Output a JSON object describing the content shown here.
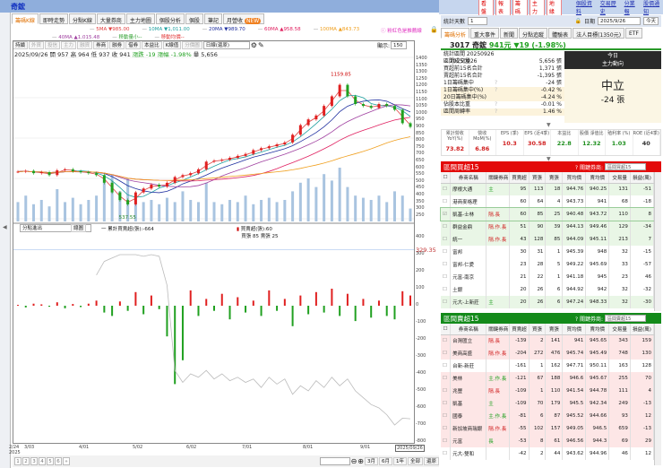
{
  "window": {
    "title": "奇鋐"
  },
  "tabs": [
    {
      "label": "籌碼K線",
      "active": true
    },
    {
      "label": "即時走勢"
    },
    {
      "label": "分點K線"
    },
    {
      "label": "大量券商"
    },
    {
      "label": "主力地圖"
    },
    {
      "label": "個股分析"
    },
    {
      "label": "個股"
    },
    {
      "label": "筆記"
    },
    {
      "label": "月營收",
      "badge": "NEW"
    }
  ],
  "ma_legend": {
    "row1": [
      {
        "label": "5MA ▼985.00",
        "color": "#e04040"
      },
      {
        "label": "10MA ▼1,011.00",
        "color": "#20a0a0"
      },
      {
        "label": "20MA ▼989.70",
        "color": "#2030a0"
      },
      {
        "label": "60MA ▲958.58",
        "color": "#e02060"
      },
      {
        "label": "100MA ▲843.73",
        "color": "#f0a020"
      }
    ],
    "row2": [
      {
        "label": "40MA ▲1,015.48",
        "color": "#a040a0"
      },
      {
        "label": "移動量小--",
        "color": "#30a030"
      },
      {
        "label": "移動均價--",
        "color": "#e03030"
      }
    ],
    "note": "ⓘ 粉紅色是推薦線"
  },
  "chart_toolbar": {
    "buttons": [
      "持續",
      "外資",
      "投信",
      "主力",
      "融資",
      "券商",
      "融劵",
      "借券",
      "本益比",
      "K線值",
      "分價圖"
    ],
    "disabled": [
      1,
      2,
      3,
      4,
      10
    ],
    "period": "日線(還原)",
    "display_label": "顯示:",
    "display_value": "150"
  },
  "info": {
    "date": "2025/09/26",
    "open": "開 957",
    "high": "高 964",
    "low": "低 937",
    "close": "收 941",
    "change": "漲跌 -19",
    "pct": "漲幅 -1.98%",
    "volume": "量 5,656"
  },
  "lower_panel": {
    "select": "分點進出",
    "button": "總圖",
    "cum_label": "一 累計買賣超(張):-664",
    "legend_net": "買賣超(張):60",
    "legend_bs": "買張 85 賣張 25",
    "highlight": "329.35"
  },
  "chart_data": [
    {
      "type": "candlestick",
      "price_ticks": [
        "1400",
        "1350",
        "1300",
        "1250",
        "1200",
        "1150",
        "1100",
        "1050",
        "1000",
        "950",
        "900",
        "850",
        "800",
        "750",
        "700",
        "650",
        "600",
        "550",
        "500",
        "450",
        "400",
        "350",
        "300",
        "250"
      ],
      "annotations": {
        "high": "1159.85",
        "low": "537.55"
      },
      "x_ticks": [
        "2/24",
        "3/03",
        "4/01",
        "5/02",
        "6/02",
        "7/01",
        "8/01",
        "9/01",
        "2025/09/26"
      ],
      "x_year": "2025",
      "closes": [
        708,
        712,
        700,
        705,
        690,
        715,
        720,
        710,
        705,
        700,
        690,
        650,
        600,
        560,
        537.55,
        600,
        620,
        640,
        630,
        650,
        680,
        690,
        700,
        720,
        760,
        765,
        770,
        780,
        790,
        800,
        820,
        830,
        840,
        850,
        860,
        900,
        950,
        980,
        1000,
        1050,
        1100,
        1159.85,
        1100,
        1060,
        1050,
        1040,
        1060,
        1050,
        1030,
        960,
        941
      ],
      "volumes": [
        9,
        12,
        8,
        10,
        7,
        15,
        9,
        11,
        8,
        10,
        12,
        18,
        22,
        14,
        20,
        12,
        9,
        10,
        8,
        11,
        9,
        14,
        10,
        9,
        18,
        9,
        8,
        10,
        9,
        12,
        8,
        10,
        11,
        9,
        10,
        14,
        18,
        20,
        16,
        22,
        19,
        25,
        16,
        12,
        11,
        10,
        12,
        9,
        14,
        12,
        6
      ]
    },
    {
      "type": "bar+line",
      "y_ticks": [
        "400",
        "300",
        "200",
        "100",
        "0",
        "-100",
        "-200",
        "-300",
        "-400",
        "-500",
        "-600",
        "-700",
        "-800"
      ],
      "net": [
        5,
        -10,
        12,
        8,
        -6,
        20,
        -15,
        10,
        -8,
        12,
        30,
        -40,
        -60,
        25,
        -30,
        80,
        -50,
        60,
        -20,
        -180,
        -460,
        -320,
        90,
        -60,
        40,
        -30,
        70,
        -80,
        50,
        -40,
        30,
        -60,
        90,
        -30,
        40,
        -120,
        60,
        -50,
        80,
        -40,
        100,
        -60,
        70,
        -90,
        40,
        -70,
        30,
        -60,
        -80,
        85,
        60
      ],
      "cumulative": [
        null,
        null,
        null,
        null,
        null,
        null,
        null,
        null,
        null,
        null,
        180,
        260,
        280,
        300,
        300,
        300,
        290,
        300,
        290,
        120,
        -380,
        -450,
        -400,
        -420,
        -380,
        -430,
        -400,
        -440,
        -420,
        -450,
        -430,
        -480,
        -420,
        -460,
        -430,
        -520,
        -470,
        -500,
        -440,
        -480,
        -420,
        -470,
        -430,
        -500,
        -540,
        -580,
        -600,
        -640,
        -700,
        -660,
        -664
      ]
    }
  ],
  "bottom": {
    "pages": [
      "1",
      "2",
      "3",
      "4",
      "5",
      "6",
      "»"
    ],
    "ranges": [
      "3月",
      "6月",
      "1年",
      "全部",
      "還原"
    ]
  },
  "right": {
    "buttons": [
      "看盤",
      "報表",
      "籌碼",
      "主力",
      "地緣"
    ],
    "links": [
      "個股資料",
      "交易歷史",
      "分業報",
      "股價通知"
    ],
    "days_label": "統計天數",
    "days_value": "1",
    "date_label": "日期",
    "date_value": "2025/9/26",
    "today_btn": "今天",
    "tabs": [
      "籌碼分析",
      "重大事件",
      "新聞",
      "分點追蹤",
      "體驗表",
      "法人目標(1350元)",
      "ETF"
    ],
    "stock": {
      "code_name": "3017 奇鋐",
      "price": "941元",
      "change": "▼19 (-1.98%)"
    },
    "stats": [
      {
        "l": "統計區間  20250926 ~ 20250926",
        "v": ""
      },
      {
        "l": "區間成交量",
        "v": "5,656 張"
      },
      {
        "l": "買超前15名合計",
        "v": "1,371 張"
      },
      {
        "l": "賣超前15名合計",
        "v": "-1,395 張"
      },
      {
        "l": "1日籌碼集中",
        "q": "?",
        "v": "-24 張"
      },
      {
        "l": "1日籌碼集中(%)",
        "q": "?",
        "v": "-0.42 %",
        "alt": true
      },
      {
        "l": "20日籌碼集中(%)",
        "v": "-4.24 %",
        "alt": true
      },
      {
        "l": "佔股本比重",
        "q": "?",
        "v": "-0.01 %"
      },
      {
        "l": "區間周轉率",
        "q": "?",
        "v": "1.46 %",
        "alt": true
      }
    ],
    "today": {
      "h1": "今日",
      "h2": "主力動向",
      "state": "中立",
      "value": "-24 張"
    },
    "fin": [
      {
        "h": "累計營收 YoY(%)",
        "v": "73.82",
        "c": "#d02020"
      },
      {
        "h": "營收 MoM(%)",
        "v": "6.86",
        "c": "#d02020"
      },
      {
        "h": "EPS (季)",
        "v": "10.3",
        "c": "#d02020"
      },
      {
        "h": "EPS (近4季)",
        "v": "30.58",
        "c": "#d02020"
      },
      {
        "h": "本益比",
        "v": "22.8",
        "c": "#209020"
      },
      {
        "h": "股價 淨值比",
        "v": "12.32",
        "c": "#209020"
      },
      {
        "h": "殖利率 (%)",
        "v": "1.03",
        "c": "#209020"
      },
      {
        "h": "ROE (近4季)",
        "v": "40",
        "c": "#333"
      }
    ],
    "columns": [
      "券商名稱",
      "關鍵券商",
      "買賣超",
      "買張",
      "賣張",
      "買均價",
      "賣均價",
      "交易量",
      "損益(萬)"
    ],
    "buy": {
      "title": "區間買超15",
      "key_label": "? 關鍵券商:",
      "select": "區間買超15",
      "color": "#e30a0a",
      "rows": [
        [
          "摩根大通",
          "主",
          "95",
          "113",
          "18",
          "944.76",
          "940.25",
          "131",
          "-51"
        ],
        [
          "港商麥格理",
          "",
          "60",
          "64",
          "4",
          "943.73",
          "941",
          "68",
          "-18"
        ],
        [
          "凱基-士林",
          "隔.長",
          "60",
          "85",
          "25",
          "940.48",
          "943.72",
          "110",
          "8"
        ],
        [
          "群益金鼎",
          "隔.作.長",
          "51",
          "90",
          "39",
          "944.13",
          "949.46",
          "129",
          "-34"
        ],
        [
          "統一",
          "隔.作.長",
          "43",
          "128",
          "85",
          "944.09",
          "945.11",
          "213",
          "7"
        ],
        [
          "富邦",
          "",
          "30",
          "31",
          "1",
          "945.39",
          "948",
          "32",
          "-15"
        ],
        [
          "富邦-仁愛",
          "",
          "23",
          "28",
          "5",
          "949.22",
          "945.69",
          "33",
          "-57"
        ],
        [
          "元富-南京",
          "",
          "21",
          "22",
          "1",
          "941.18",
          "945",
          "23",
          "46"
        ],
        [
          "土銀",
          "",
          "20",
          "26",
          "6",
          "944.92",
          "942",
          "32",
          "-32"
        ],
        [
          "元大-上新莊",
          "主",
          "20",
          "26",
          "6",
          "947.24",
          "948.33",
          "32",
          "-30"
        ]
      ]
    },
    "sell": {
      "title": "區間賣超15",
      "key_label": "? 關鍵券商:",
      "select": "區間賣超15",
      "color": "#138a1a",
      "rows": [
        [
          "台灣匯立",
          "隔.長",
          "-139",
          "2",
          "141",
          "941",
          "945.65",
          "343",
          "159"
        ],
        [
          "美商高盛",
          "隔.作.長",
          "-204",
          "272",
          "476",
          "945.74",
          "945.49",
          "748",
          "130"
        ],
        [
          "台新-新莊",
          "",
          "-161",
          "1",
          "162",
          "947.71",
          "950.11",
          "163",
          "128"
        ],
        [
          "美林",
          "主.作.長",
          "-121",
          "67",
          "188",
          "946.6",
          "945.67",
          "255",
          "70"
        ],
        [
          "兆豐",
          "隔.長",
          "-109",
          "1",
          "110",
          "941.54",
          "944.78",
          "111",
          "4"
        ],
        [
          "凱基",
          "主",
          "-109",
          "70",
          "179",
          "945.5",
          "942.34",
          "249",
          "-13"
        ],
        [
          "國泰",
          "主.作.長",
          "-81",
          "6",
          "87",
          "945.52",
          "944.66",
          "93",
          "12"
        ],
        [
          "新加坡商瑞銀",
          "隔.作.長",
          "-55",
          "102",
          "157",
          "949.05",
          "946.5",
          "659",
          "-13"
        ],
        [
          "元富",
          "長",
          "-53",
          "8",
          "61",
          "946.56",
          "944.3",
          "69",
          "29"
        ],
        [
          "元大-雙和",
          "",
          "-42",
          "2",
          "44",
          "943.62",
          "944.96",
          "46",
          "12"
        ]
      ]
    }
  }
}
